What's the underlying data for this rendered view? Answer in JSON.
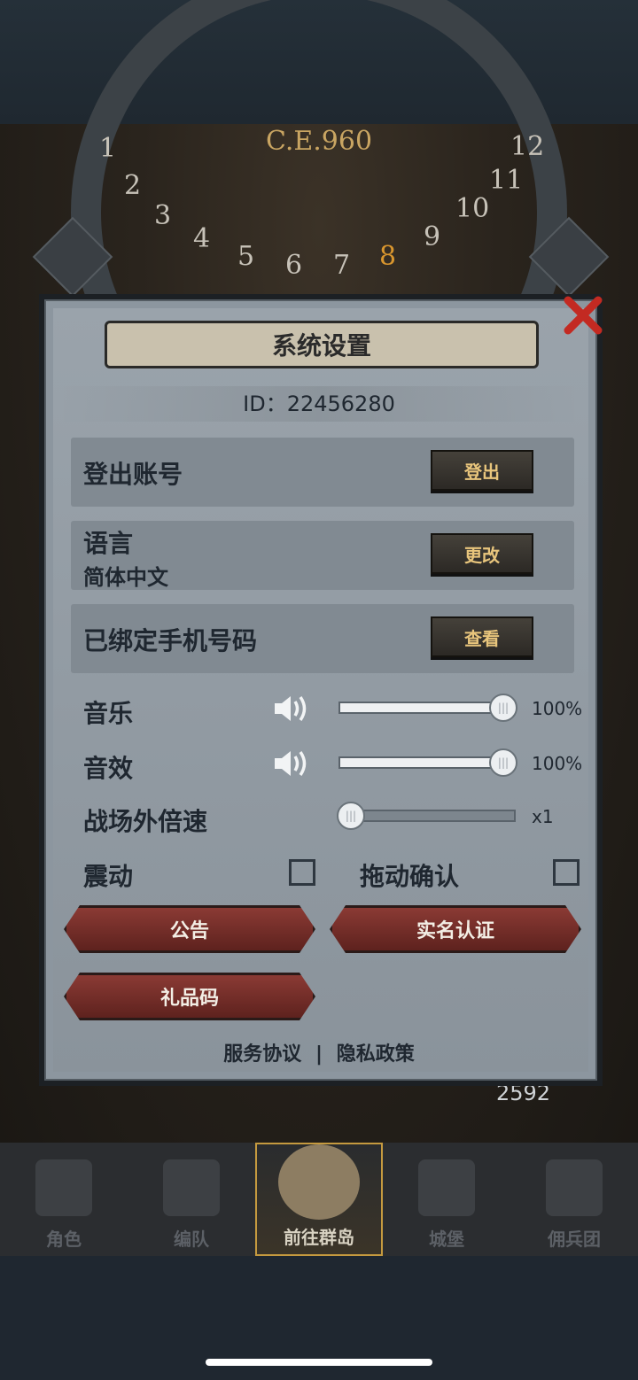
{
  "era": "C.E.960",
  "dial_numbers": [
    "1",
    "2",
    "3",
    "4",
    "5",
    "6",
    "7",
    "8",
    "9",
    "10",
    "11",
    "12"
  ],
  "dial_highlight": "8",
  "panel": {
    "title": "系统设置",
    "id_text": "ID：22456280",
    "close_icon": "close-x-icon",
    "rows": [
      {
        "label": "登出账号",
        "sub": "",
        "button": "登出"
      },
      {
        "label": "语言",
        "sub": "简体中文",
        "button": "更改"
      },
      {
        "label": "已绑定手机号码",
        "sub": "",
        "button": "查看"
      }
    ],
    "music": {
      "label": "音乐",
      "value_text": "100%",
      "level": 1.0
    },
    "sfx": {
      "label": "音效",
      "value_text": "100%",
      "level": 1.0
    },
    "speed": {
      "label": "战场外倍速",
      "value_text": "x1",
      "level": 0.0
    },
    "vibration": {
      "label": "震动",
      "checked": false
    },
    "drag_confirm": {
      "label": "拖动确认",
      "checked": false
    },
    "buttons": {
      "announcement": "公告",
      "real_name": "实名认证",
      "gift_code": "礼品码"
    },
    "footer": {
      "service": "服务协议",
      "separator": "|",
      "privacy": "隐私政策"
    }
  },
  "gem_count": "2592",
  "tabs": [
    {
      "label": "角色",
      "icon": "knight-icon"
    },
    {
      "label": "编队",
      "icon": "helmet-icon"
    },
    {
      "label": "前往群岛",
      "icon": "compass-map-icon",
      "active": true
    },
    {
      "label": "城堡",
      "icon": "castle-icon"
    },
    {
      "label": "佣兵团",
      "icon": "banner-icon"
    }
  ],
  "colors": {
    "accent_gold": "#c59a3f",
    "button_text": "#e8c57c",
    "red_button": "#8a3a34",
    "close_red": "#c32a22"
  }
}
